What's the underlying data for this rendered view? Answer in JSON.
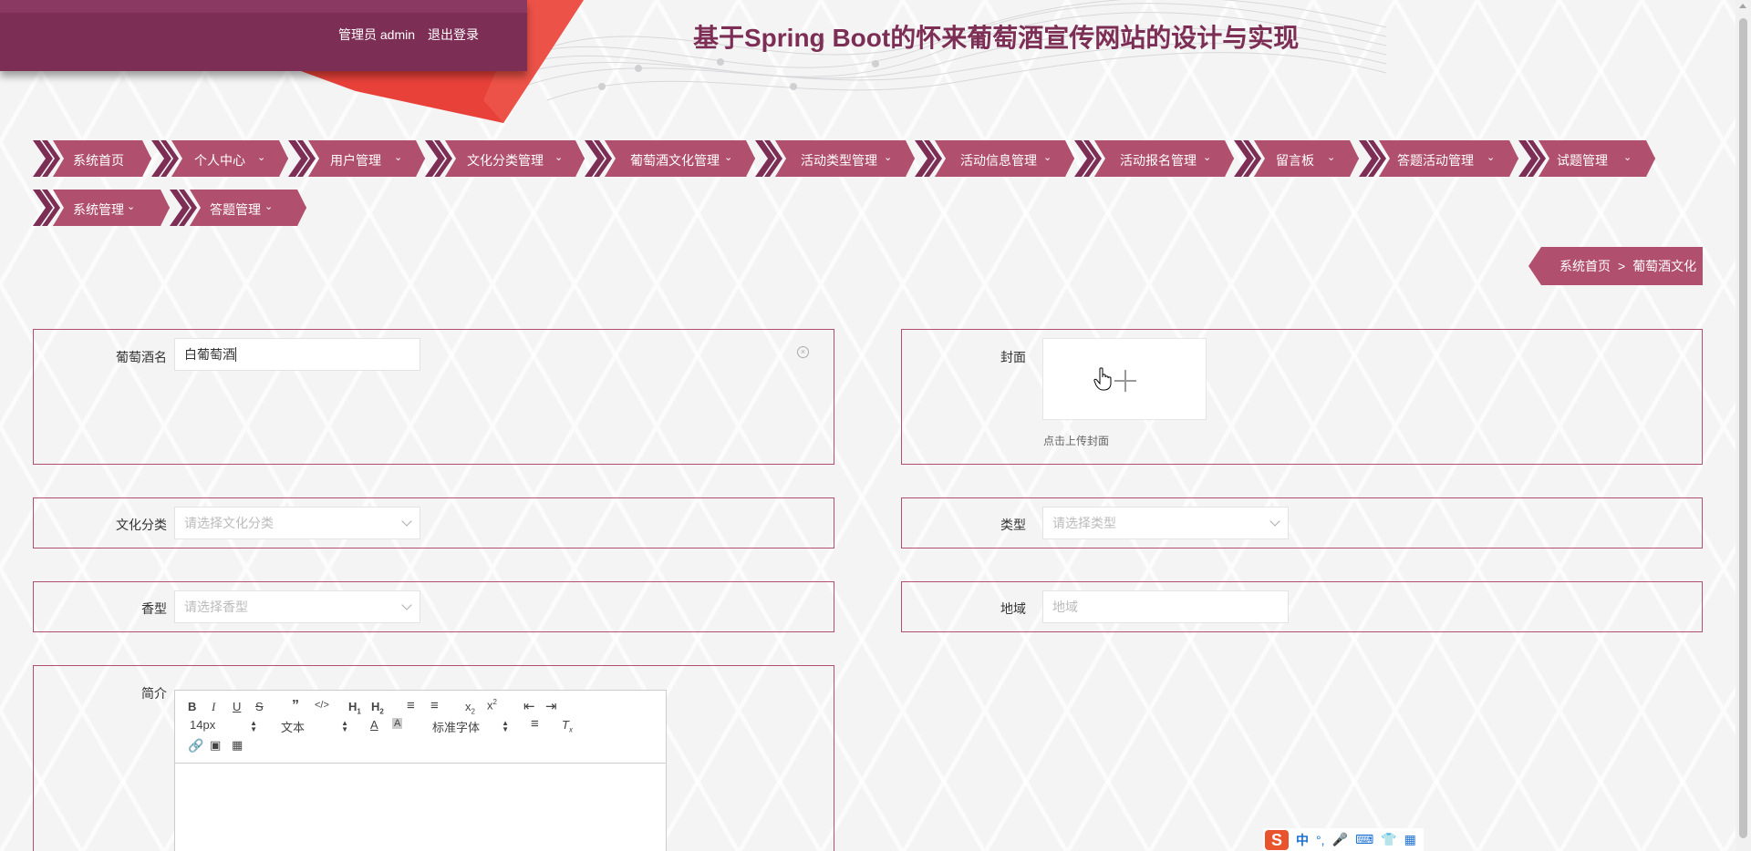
{
  "header": {
    "user_label": "管理员 admin",
    "logout_label": "退出登录",
    "site_title": "基于Spring Boot的怀来葡萄酒宣传网站的设计与实现"
  },
  "nav": {
    "items": [
      {
        "label": "系统首页",
        "has_dropdown": false
      },
      {
        "label": "个人中心",
        "has_dropdown": true
      },
      {
        "label": "用户管理",
        "has_dropdown": true
      },
      {
        "label": "文化分类管理",
        "has_dropdown": true
      },
      {
        "label": "葡萄酒文化管理",
        "has_dropdown": true
      },
      {
        "label": "活动类型管理",
        "has_dropdown": true
      },
      {
        "label": "活动信息管理",
        "has_dropdown": true
      },
      {
        "label": "活动报名管理",
        "has_dropdown": true
      },
      {
        "label": "留言板",
        "has_dropdown": true
      },
      {
        "label": "答题活动管理",
        "has_dropdown": true
      },
      {
        "label": "试题管理",
        "has_dropdown": true
      },
      {
        "label": "系统管理",
        "has_dropdown": true
      },
      {
        "label": "答题管理",
        "has_dropdown": true
      }
    ]
  },
  "breadcrumb": {
    "home": "系统首页",
    "separator": ">",
    "current": "葡萄酒文化"
  },
  "form": {
    "wine_name": {
      "label": "葡萄酒名",
      "value": "白葡萄酒"
    },
    "cover": {
      "label": "封面",
      "hint": "点击上传封面"
    },
    "culture_category": {
      "label": "文化分类",
      "placeholder": "请选择文化分类"
    },
    "type": {
      "label": "类型",
      "placeholder": "请选择类型"
    },
    "aroma": {
      "label": "香型",
      "placeholder": "请选择香型"
    },
    "region": {
      "label": "地域",
      "placeholder": "地域"
    },
    "intro": {
      "label": "简介"
    }
  },
  "editor": {
    "font_size": "14px",
    "paragraph": "文本",
    "font_family": "标准字体"
  },
  "ime": {
    "mode": "中"
  },
  "colors": {
    "primary": "#7d2e55",
    "nav_bg": "#b14f6e",
    "accent_red": "#e8413a"
  }
}
